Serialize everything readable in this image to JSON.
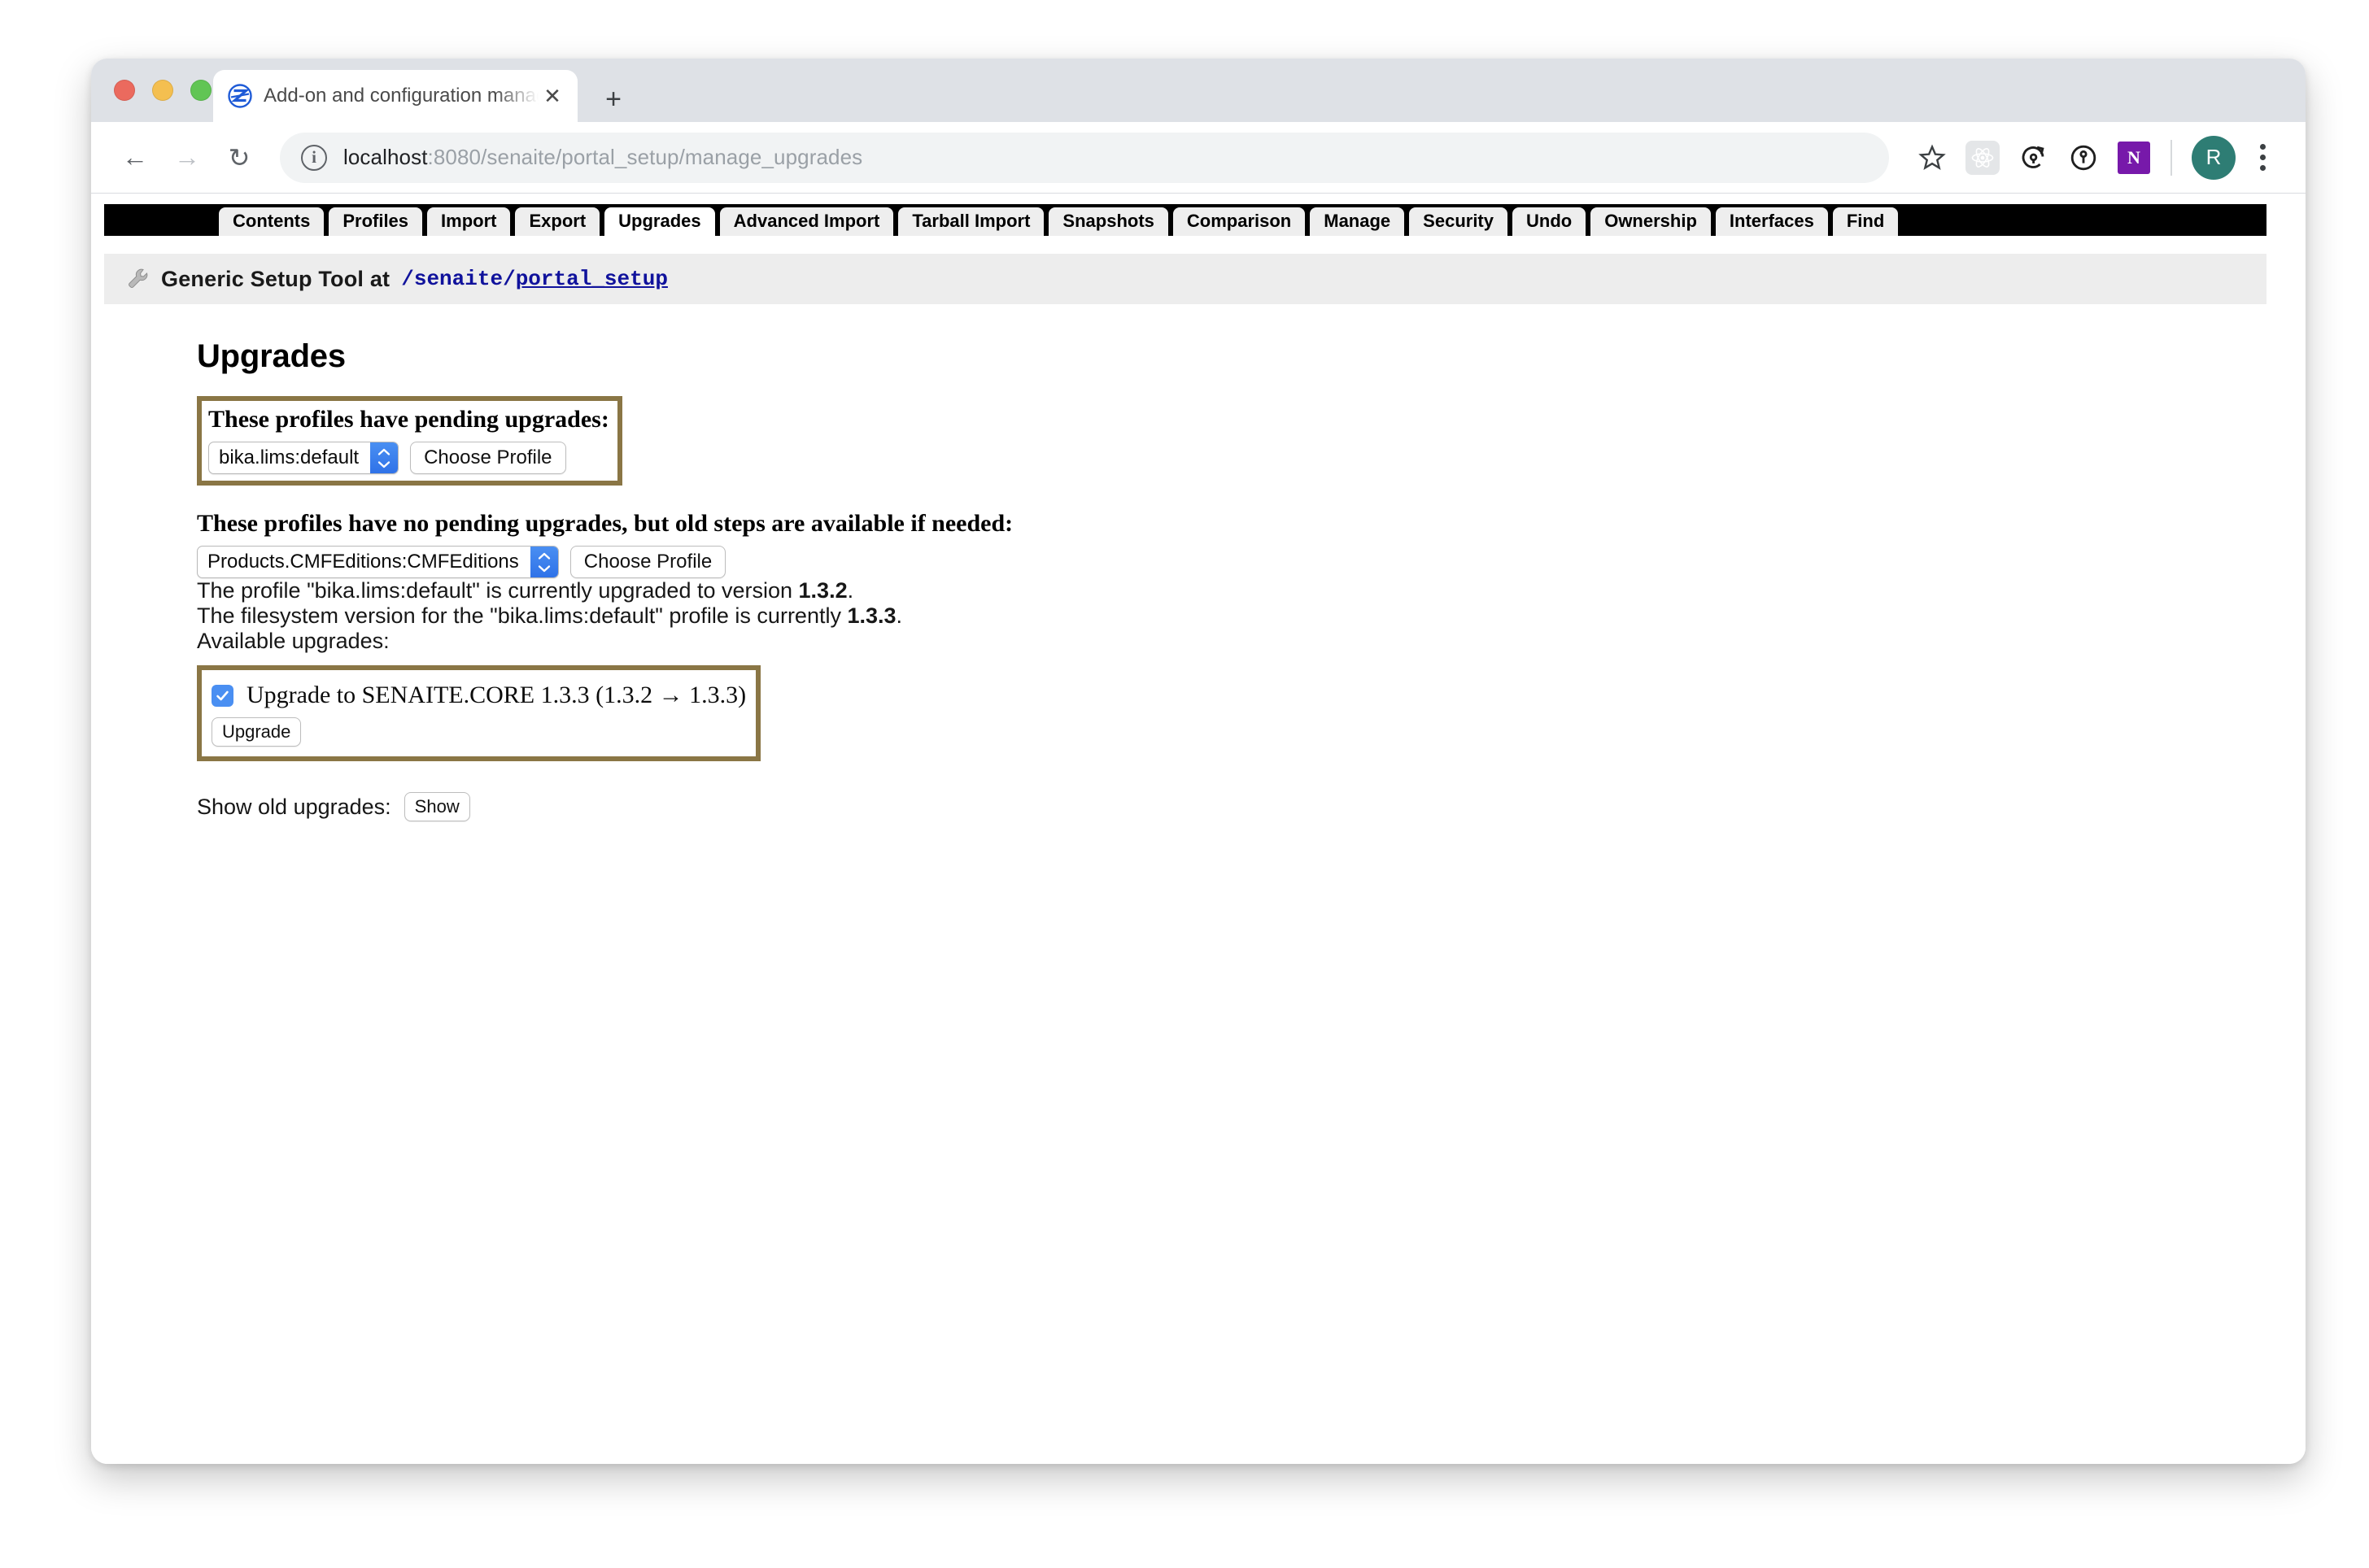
{
  "browser": {
    "tab": {
      "title": "Add-on and configuration manag",
      "favicon_name": "zope-favicon",
      "close_glyph": "✕"
    },
    "new_tab_glyph": "+",
    "nav": {
      "back_glyph": "←",
      "forward_glyph": "→",
      "reload_glyph": "↻"
    },
    "omnibox": {
      "info_glyph": "i",
      "url_host": "localhost",
      "url_rest": ":8080/senaite/portal_setup/manage_upgrades",
      "url_full": "localhost:8080/senaite/portal_setup/manage_upgrades"
    },
    "toolbar_icons": [
      {
        "name": "bookmark-star-icon",
        "glyph": "☆"
      },
      {
        "name": "react-devtools-extension-icon",
        "glyph": ""
      },
      {
        "name": "history-sync-extension-icon",
        "glyph": ""
      },
      {
        "name": "one-password-extension-icon",
        "glyph": ""
      },
      {
        "name": "onenote-extension-icon",
        "glyph": "N"
      }
    ],
    "profile_initial": "R",
    "menu_name": "chrome-menu-kebab"
  },
  "zmi": {
    "tabs": [
      {
        "label": "Contents",
        "active": false
      },
      {
        "label": "Profiles",
        "active": false
      },
      {
        "label": "Import",
        "active": false
      },
      {
        "label": "Export",
        "active": false
      },
      {
        "label": "Upgrades",
        "active": true
      },
      {
        "label": "Advanced Import",
        "active": false
      },
      {
        "label": "Tarball Import",
        "active": false
      },
      {
        "label": "Snapshots",
        "active": false
      },
      {
        "label": "Comparison",
        "active": false
      },
      {
        "label": "Manage",
        "active": false
      },
      {
        "label": "Security",
        "active": false
      },
      {
        "label": "Undo",
        "active": false
      },
      {
        "label": "Ownership",
        "active": false
      },
      {
        "label": "Interfaces",
        "active": false
      },
      {
        "label": "Find",
        "active": false
      }
    ],
    "breadcrumb": {
      "icon_name": "wrench-icon",
      "text": "Generic Setup Tool at",
      "path_root": "/senaite",
      "path_sep": "/",
      "path_leaf": "portal_setup"
    }
  },
  "page": {
    "title": "Upgrades",
    "pending": {
      "heading": "These profiles have pending upgrades:",
      "select_value": "bika.lims:default",
      "button_label": "Choose Profile",
      "highlight_color": "#8a7645"
    },
    "no_pending": {
      "heading": "These profiles have no pending upgrades, but old steps are available if needed:",
      "select_value": "Products.CMFEditions:CMFEditions",
      "button_label": "Choose Profile"
    },
    "status_lines": [
      {
        "prefix": "The profile \"bika.lims:default\" is currently upgraded to version ",
        "version": "1.3.2",
        "suffix": "."
      },
      {
        "prefix": "The filesystem version for the \"bika.lims:default\" profile is currently ",
        "version": "1.3.3",
        "suffix": "."
      }
    ],
    "available_label": "Available upgrades:",
    "upgrade": {
      "checked": true,
      "label": "Upgrade to SENAITE.CORE 1.3.3 (1.3.2 → 1.3.3)",
      "button_label": "Upgrade",
      "highlight_color": "#8a7645"
    },
    "show_old": {
      "label": "Show old upgrades:",
      "button_label": "Show"
    }
  }
}
